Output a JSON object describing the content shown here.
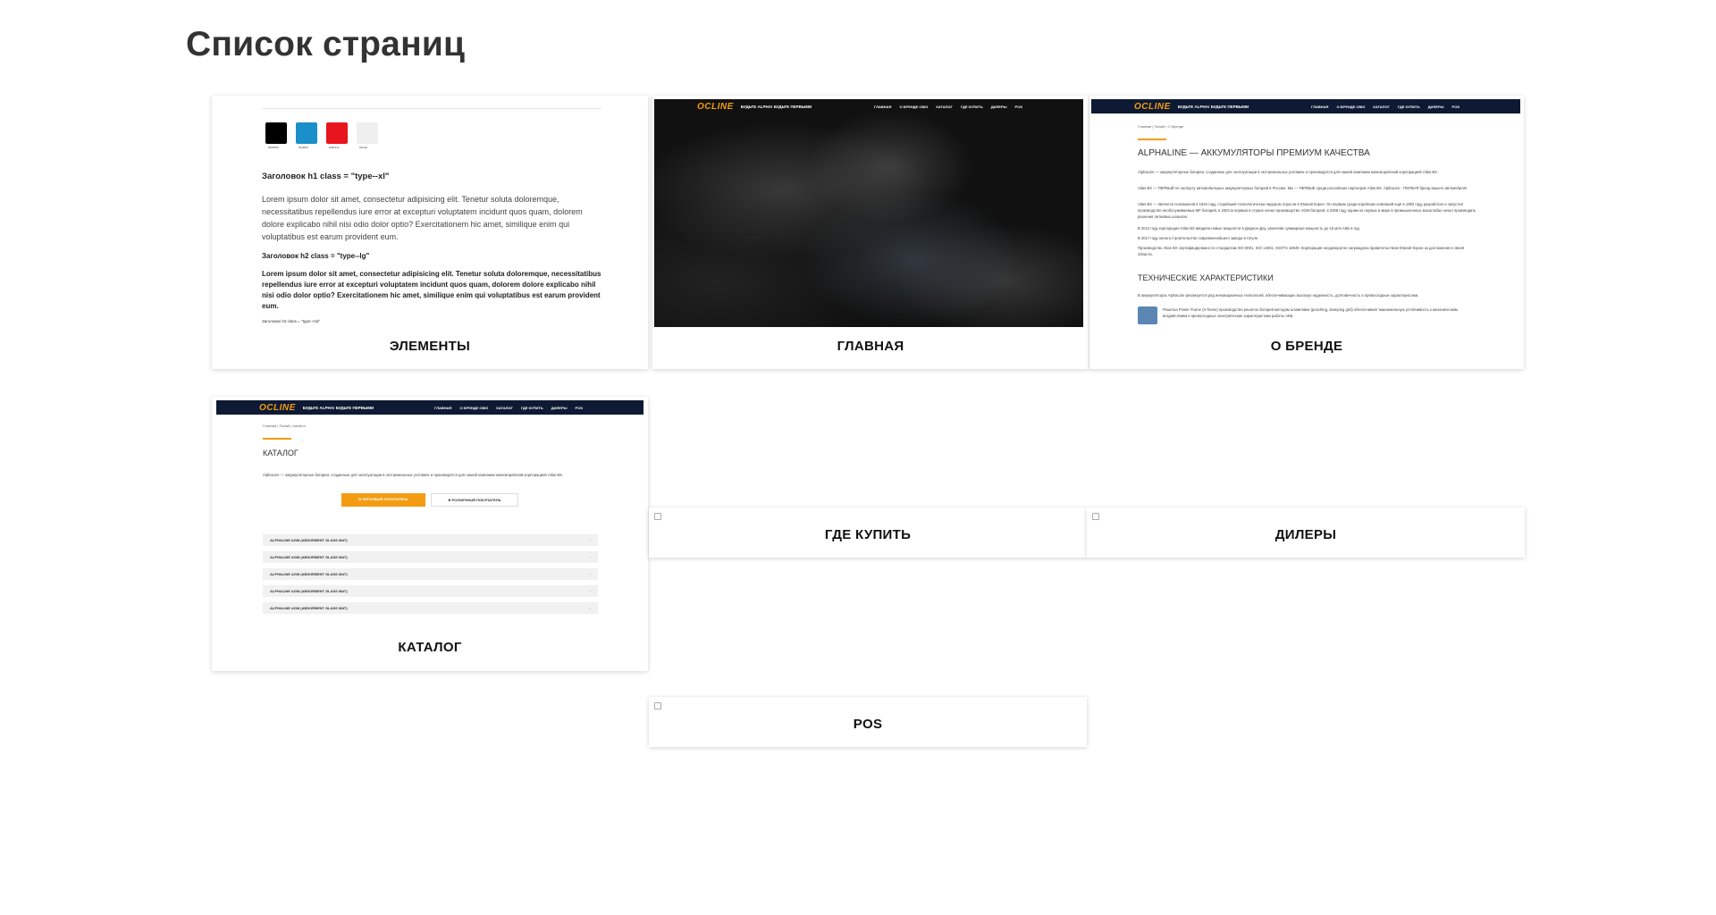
{
  "page_title": "Список страниц",
  "cards": {
    "elements": {
      "label": "ЭЛЕМЕНТЫ",
      "swatch_colors": [
        "#000000",
        "#1a8fc9",
        "#e8141e",
        "#efefef"
      ],
      "swatch_labels": [
        "#000000",
        "#1a8fc9",
        "#e8141e",
        "#efefef"
      ],
      "h1": "Заголовок h1 class = \"type--xl\"",
      "p1": "Lorem ipsum dolor sit amet, consectetur adipisicing elit. Tenetur soluta doloremque, necessitatibus repellendus iure error at excepturi voluptatem incidunt quos quam, dolorem dolore explicabo nihil nisi odio dolor optio? Exercitationem hic amet, similique enim qui voluptatibus est earum provident eum.",
      "h2": "Заголовок h2 class = \"type--lg\"",
      "p2": "Lorem ipsum dolor sit amet, consectetur adipisicing elit. Tenetur soluta doloremque, necessitatibus repellendus iure error at excepturi voluptatem incidunt quos quam, dolorem dolore explicabo nihil nisi odio dolor optio? Exercitationem hic amet, similique enim qui voluptatibus est earum provident eum.",
      "h3": "Заголовок h3 class = \"type--md\""
    },
    "main": {
      "label": "ГЛАВНАЯ"
    },
    "about": {
      "label": "О БРЕНДЕ",
      "breadcrumb": "Главная | Папаб | О бренде",
      "heading": "ALPHALINE — АККУМУЛЯТОРЫ ПРЕМИУМ КАЧЕСТВА",
      "paragraphs": [
        "AlphaLine — аккумуляторные батареи, созданные для эксплуатации в экстремальных условиях и производятся для нашей компании южнокорейской корпорацией Atlas BX.",
        "Atlas BX — ПЕРВЫЙ по экспорту автомобильных аккумуляторных батарей в Россию. Мы — ПЕРВЫЕ среди российских партнеров Atlas BX. AlphaLine - ПЕРВАЯ бренд вашего автомобиля!",
        "Atlas BX — является основанной в 1944 году, старейшей технологически-лидером отрасли в Южной Корее. Он первым среди корейских компаний ещё в 1982 году разработал и запустил производство необслуживаемых MF батарей, в 2003 м первым в стране начал производство AGM-батарей, в 2008 году одним из первых в мире в промышленных масштабах начал производить решения литиевых шлангов.",
        "В 2014 году корпорация Atlas BX вводила новые мощности в Деджон-Доу, увеличив суммарную мощность до 15 млн АКБ в год.",
        "В 2017 году начата строительство современнейшего завода в Сёуле.",
        "Производство Atlas BX сертифицировано по стандартам ISO 9001, ISO 14001, ISO/TS 16949. Корпорация неоднократно награждена правительством Южной Кореи за достижения в своей области."
      ],
      "heading2": "ТЕХНИЧЕСКИЕ ХАРАКТЕРИСТИКИ",
      "tech_intro": "В аккумуляторах AlphaLine реализуется ряд инновационных технологий, обеспечивающих высокую надежность, долговечность и превосходные характеристики.",
      "tech_item": "Решетка Power Frame (X-frame) производство решеток батарей методом штамповки (punching, stamping grid) обеспечивает максимальную устойчивость к механическим воздействиям и превосходные электрические характеристики работы АКБ."
    },
    "catalog": {
      "label": "КАТАЛОГ",
      "breadcrumb": "Главная | Папаб | Каталог",
      "heading": "КАТАЛОГ",
      "intro": "AlphaLine — аккумуляторные батареи, созданные для эксплуатации в экстремальных условиях и производятся для нашей компании южнокорейской корпорацией Atlas BX.",
      "btn_primary": "В ЛЕГКОВЫЙ ПОКУПАТЕЛЬ",
      "btn_secondary": "В РОЗНИЧНЫЙ ПОКУПАТЕЛЬ",
      "rows": [
        "ALPHALINE AGM (ABSORBENT GLASS MAT)",
        "ALPHALINE AGM (ABSORBENT GLASS MAT)",
        "ALPHALINE AGM (ABSORBENT GLASS MAT)",
        "ALPHALINE AGM (ABSORBENT GLASS MAT)",
        "ALPHALINE AGM (ABSORBENT GLASS MAT)"
      ]
    },
    "where_to_buy": {
      "label": "ГДЕ КУПИТЬ"
    },
    "dealers": {
      "label": "ДИЛЕРЫ"
    },
    "pos": {
      "label": "POS"
    }
  },
  "site_nav": {
    "logo": "OCLINE",
    "slogan": "БУДЬТЕ ALPHA! БУДЬТЕ ПЕРВЫМИ",
    "menu": [
      "ГЛАВНАЯ",
      "О БРЕНДЕ CBIG",
      "КАТАЛОГ",
      "ГДЕ КУПИТЬ",
      "ДИЛЕРЫ",
      "POS"
    ]
  },
  "colors": {
    "accent": "#f39c12",
    "nav_bg": "#0e1a33"
  }
}
